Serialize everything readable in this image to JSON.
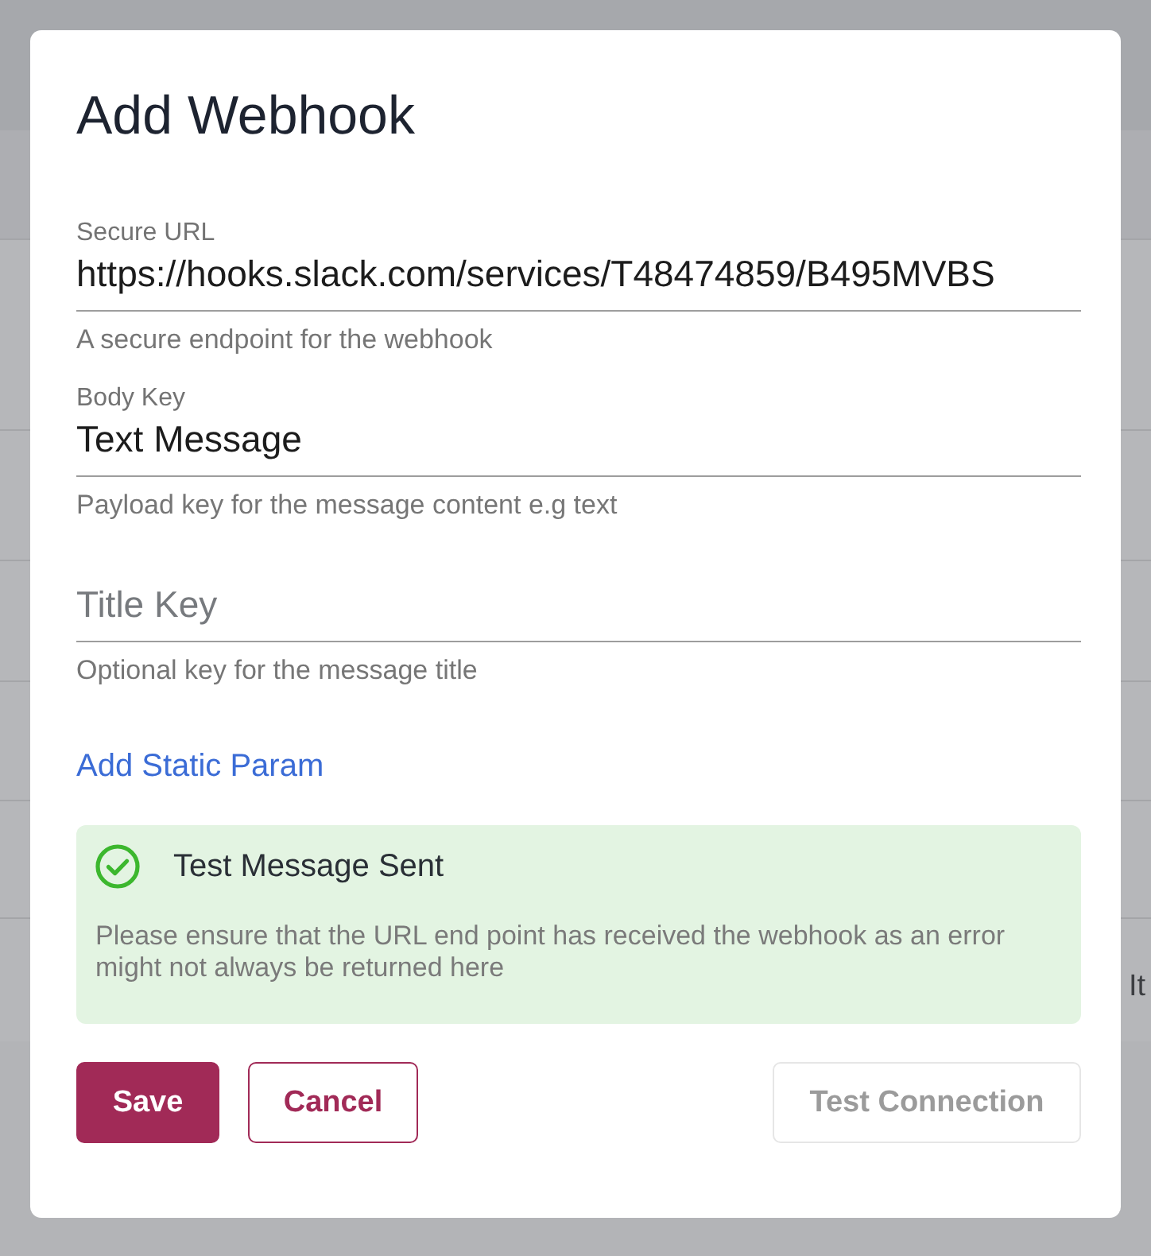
{
  "background": {
    "row_text": "It"
  },
  "dialog": {
    "title": "Add Webhook"
  },
  "fields": [
    {
      "label": "Secure URL",
      "value": "https://hooks.slack.com/services/T48474859/B495MVBS",
      "helper": "A secure endpoint for the webhook"
    },
    {
      "label": "Body Key",
      "value": "Text Message",
      "helper": "Payload key for the message content e.g text"
    },
    {
      "placeholder": "Title Key",
      "helper": "Optional key for the message title"
    }
  ],
  "add_param_link": {
    "label": "Add Static Param"
  },
  "alert": {
    "kind": "success",
    "title": "Test Message Sent",
    "message": "Please ensure that the URL end point has received the webhook as an error might not always be returned here"
  },
  "buttons": [
    {
      "label": "Save",
      "kind": "primary",
      "disabled": false
    },
    {
      "label": "Cancel",
      "kind": "outline",
      "disabled": false
    },
    {
      "label": "Test Connection",
      "kind": "secondary",
      "disabled": true
    }
  ]
}
